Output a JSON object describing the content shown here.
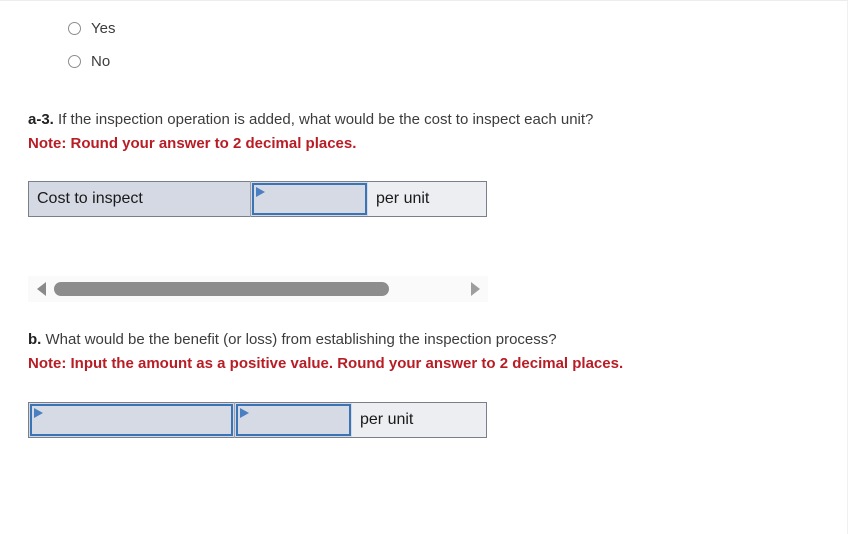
{
  "radio_group": {
    "name": "inspection-added-choice",
    "options": [
      {
        "label": "Yes",
        "selected": false
      },
      {
        "label": "No",
        "selected": false
      }
    ]
  },
  "question_a3": {
    "label": "a-3.",
    "text": "If the inspection operation is added, what would be the cost to inspect each unit?",
    "note": "Note: Round your answer to 2 decimal places.",
    "note_color": "#b81d26",
    "table": {
      "row_label": "Cost to inspect",
      "input_value": "",
      "unit": "per unit"
    }
  },
  "scrollbar": {
    "left_arrow": "triangle-left",
    "right_arrow": "triangle-right",
    "thumb_percent": 82
  },
  "question_b": {
    "label": "b.",
    "text": "What would be the benefit (or loss) from establishing the inspection process?",
    "note": "Note: Input the amount as a positive value. Round your answer to 2 decimal places.",
    "note_color": "#b81d26",
    "table": {
      "input_value_1": "",
      "input_value_2": "",
      "unit": "per unit"
    }
  }
}
